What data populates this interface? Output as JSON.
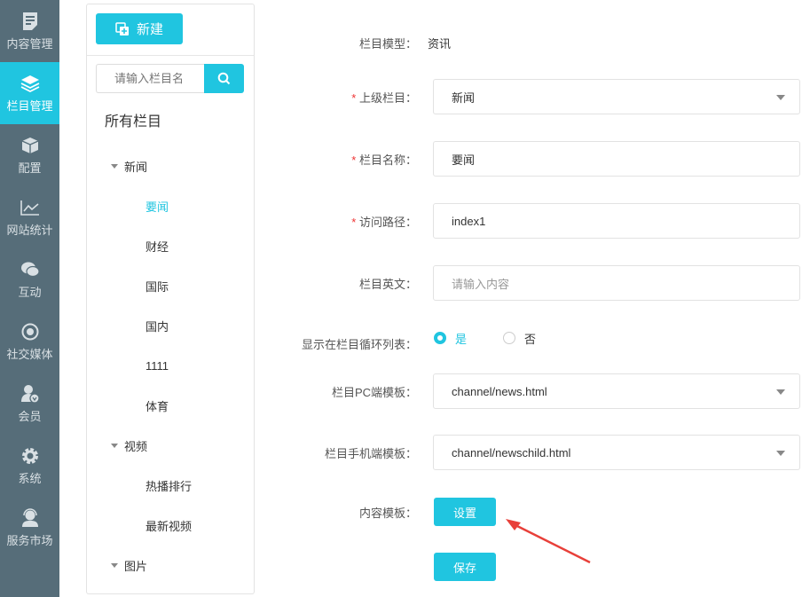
{
  "accent": "#20c5e0",
  "nav": [
    {
      "label": "内容管理",
      "icon": "document-icon"
    },
    {
      "label": "栏目管理",
      "icon": "layers-icon",
      "active": true
    },
    {
      "label": "配置",
      "icon": "box-icon"
    },
    {
      "label": "网站统计",
      "icon": "line-chart-icon"
    },
    {
      "label": "互动",
      "icon": "chat-icon"
    },
    {
      "label": "社交媒体",
      "icon": "social-icon"
    },
    {
      "label": "会员",
      "icon": "member-icon"
    },
    {
      "label": "系统",
      "icon": "gear-icon"
    },
    {
      "label": "服务市场",
      "icon": "support-icon"
    }
  ],
  "panel": {
    "new_label": "新建",
    "search_placeholder": "请输入栏目名",
    "all_label": "所有栏目",
    "tree": [
      {
        "label": "新闻",
        "type": "parent"
      },
      {
        "label": "要闻",
        "type": "child",
        "active": true
      },
      {
        "label": "财经",
        "type": "child"
      },
      {
        "label": "国际",
        "type": "child"
      },
      {
        "label": "国内",
        "type": "child"
      },
      {
        "label": "1111",
        "type": "child"
      },
      {
        "label": "体育",
        "type": "child"
      },
      {
        "label": "视频",
        "type": "parent"
      },
      {
        "label": "热播排行",
        "type": "child"
      },
      {
        "label": "最新视频",
        "type": "child"
      },
      {
        "label": "图片",
        "type": "parent"
      }
    ]
  },
  "form": {
    "model_label": "栏目模型：",
    "model_value": "资讯",
    "parent_label": "上级栏目：",
    "parent_value": "新闻",
    "name_label": "栏目名称：",
    "name_value": "要闻",
    "path_label": "访问路径：",
    "path_value": "index1",
    "english_label": "栏目英文：",
    "english_placeholder": "请输入内容",
    "show_label": "显示在栏目循环列表：",
    "yes": "是",
    "no": "否",
    "pc_label": "栏目PC端模板：",
    "pc_value": "channel/news.html",
    "mobile_label": "栏目手机端模板：",
    "mobile_value": "channel/newschild.html",
    "content_label": "内容模板：",
    "set_label": "设置",
    "save_label": "保存",
    "required_mark": "*"
  }
}
